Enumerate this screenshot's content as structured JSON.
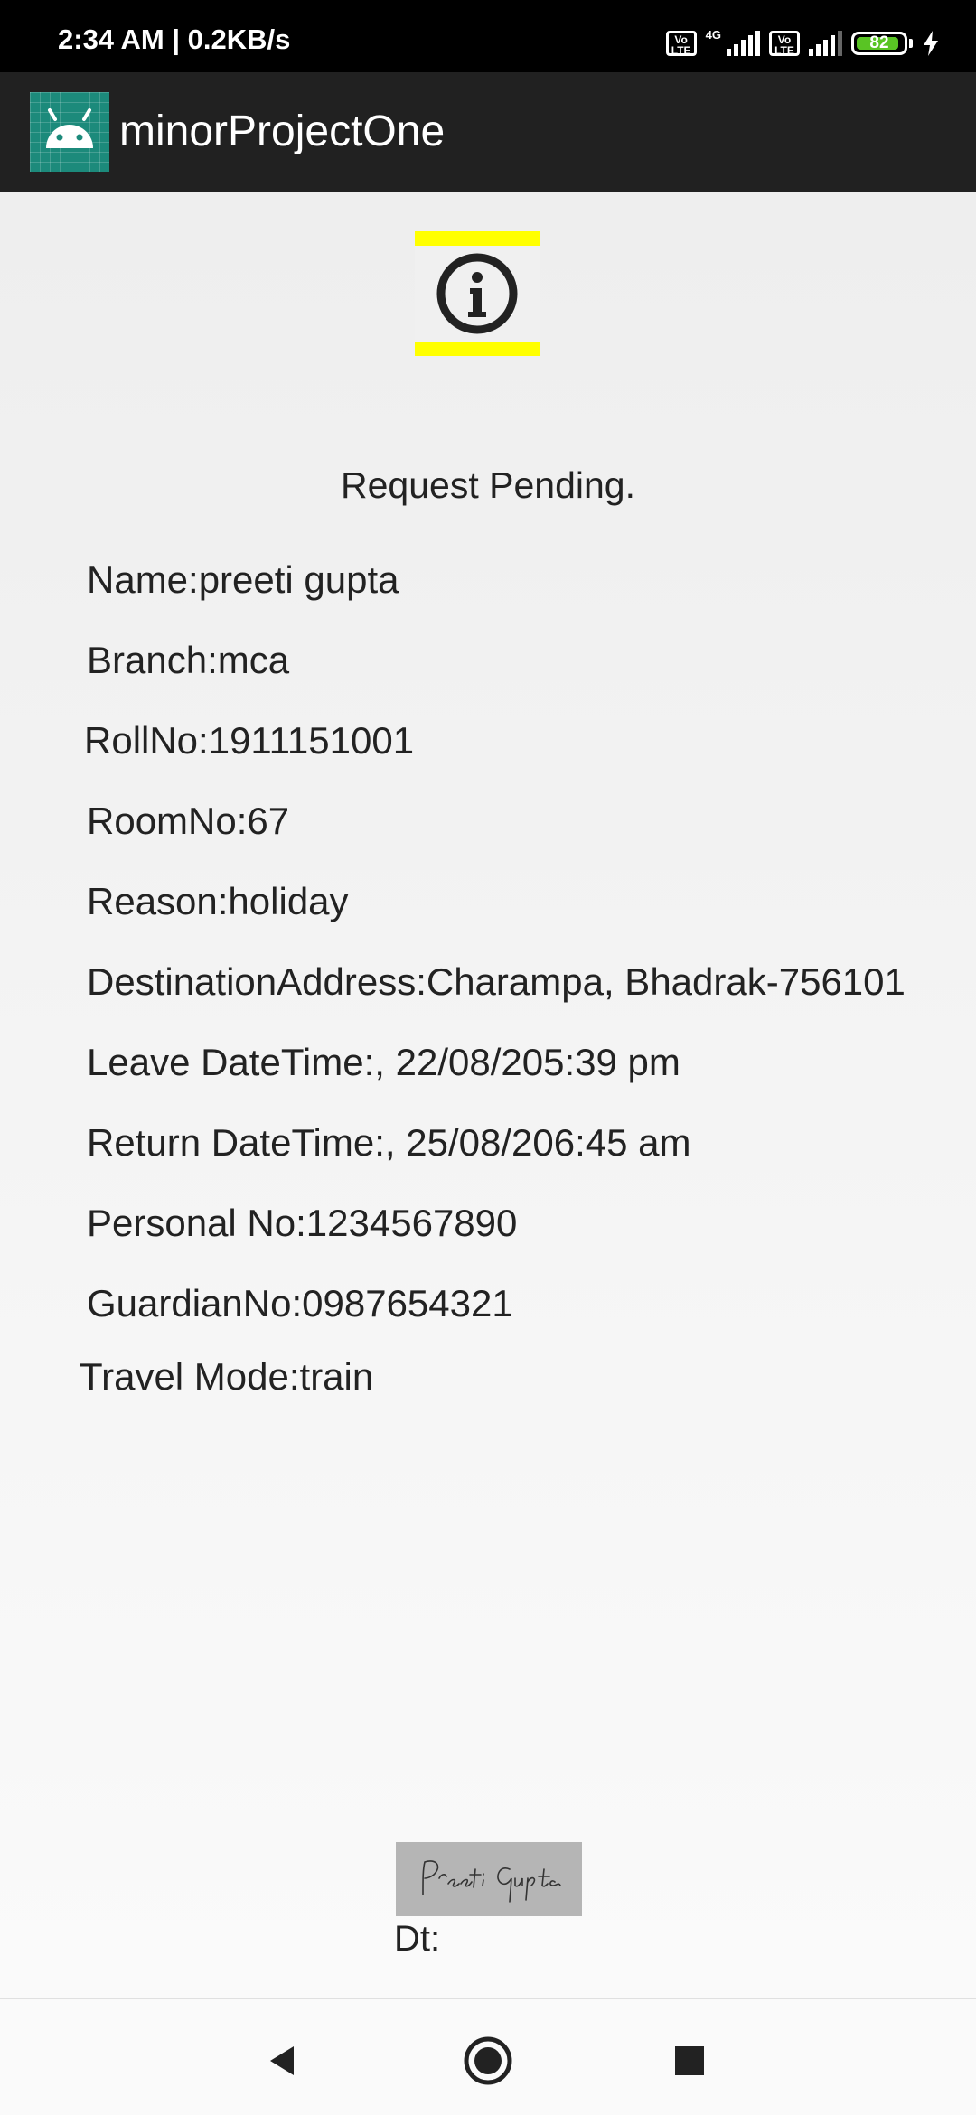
{
  "status_bar": {
    "time_speed": "2:34 AM | 0.2KB/s",
    "net_label": "4G",
    "volte_label": "Vo LTE",
    "battery_level": "82",
    "icons": [
      "volte-icon",
      "signal-icon",
      "battery-icon",
      "charging-icon"
    ]
  },
  "app_bar": {
    "title": "minorProjectOne",
    "icon": "android-app-icon",
    "icon_color": "#1c8a7b"
  },
  "request": {
    "status_icon": "info-icon",
    "status_text": "Request Pending.",
    "fields": [
      "Name:preeti gupta",
      "Branch:mca",
      "RollNo:1911151001",
      "RoomNo:67",
      "Reason:holiday",
      "DestinationAddress:Charampa, Bhadrak-756101",
      "Leave DateTime:, 22/08/205:39 pm",
      "Return DateTime:, 25/08/206:45 am",
      "Personal No:1234567890",
      "GuardianNo:0987654321",
      "Travel Mode:train"
    ],
    "signature_text": "Preeti Gupta",
    "date_label": "Dt:"
  },
  "nav_bar": {
    "icons": [
      "back-icon",
      "home-icon",
      "recents-icon"
    ]
  },
  "colors": {
    "status_bar": "#000000",
    "app_bar": "#212121",
    "info_highlight": "#ffff00",
    "battery_fill": "#59c424"
  }
}
